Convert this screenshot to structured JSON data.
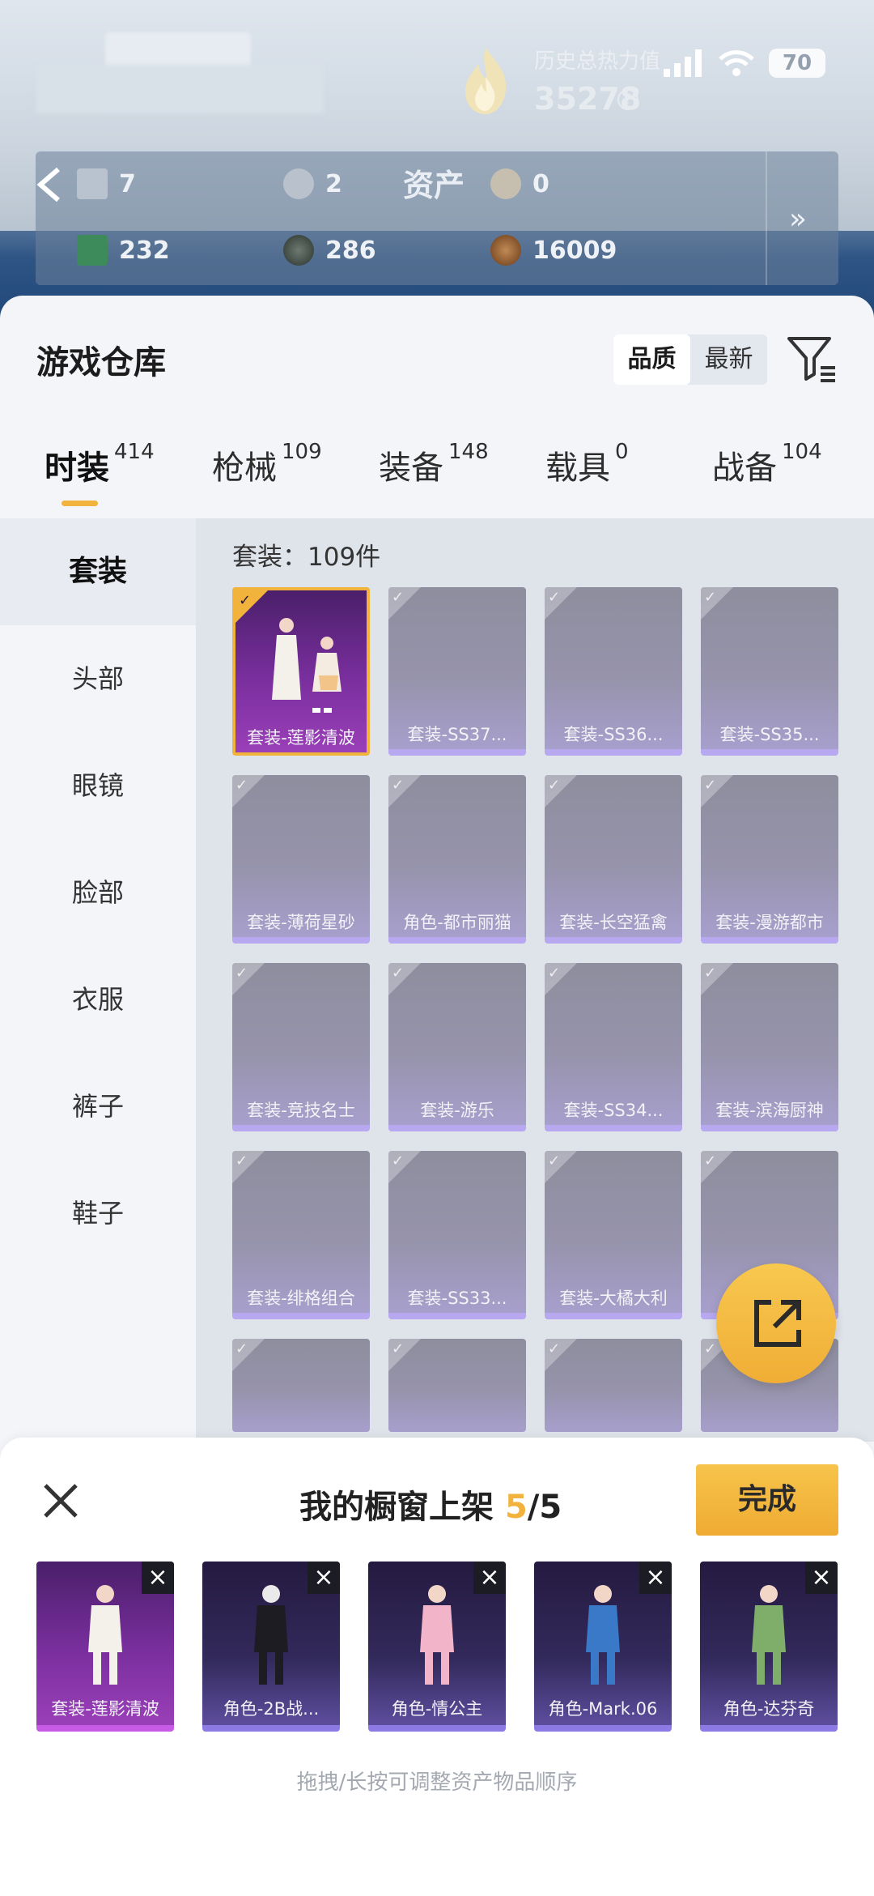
{
  "header": {
    "heat_label": "历史总热力值",
    "heat_value": "35278",
    "heat_help": "?",
    "battery": "70",
    "assets_title": "资产",
    "assets_top": [
      {
        "icon": "ticket-icon",
        "value": "7"
      },
      {
        "icon": "coin-silver-icon",
        "value": "2"
      },
      {
        "icon": "coin-gold-icon",
        "value": "0"
      }
    ],
    "assets_bottom": [
      {
        "icon": "green-card-icon",
        "value": "232"
      },
      {
        "icon": "dark-coin-icon",
        "value": "286"
      },
      {
        "icon": "bronze-coin-icon",
        "value": "16009"
      }
    ],
    "more_arrow": "»"
  },
  "warehouse": {
    "title": "游戏仓库",
    "sort_options": [
      "品质",
      "最新"
    ],
    "active_sort": "品质"
  },
  "tabs": [
    {
      "label": "时装",
      "count": "414"
    },
    {
      "label": "枪械",
      "count": "109"
    },
    {
      "label": "装备",
      "count": "148"
    },
    {
      "label": "载具",
      "count": "0"
    },
    {
      "label": "战备",
      "count": "104"
    }
  ],
  "sidebar": {
    "items": [
      "套装",
      "头部",
      "眼镜",
      "脸部",
      "衣服",
      "裤子",
      "鞋子"
    ]
  },
  "grid": {
    "count_label": "套装：109件",
    "items": [
      "套装-莲影清波",
      "套装-SS37...",
      "套装-SS36...",
      "套装-SS35...",
      "套装-薄荷星砂",
      "角色-都市丽猫",
      "套装-长空猛禽",
      "套装-漫游都市",
      "套装-竞技名士",
      "套装-游乐",
      "套装-SS34...",
      "套装-滨海厨神",
      "套装-绯格组合",
      "套装-SS33...",
      "套装-大橘大利",
      "",
      "",
      "",
      "",
      ""
    ]
  },
  "sheet": {
    "title_prefix": "我的橱窗上架 ",
    "title_current": "5",
    "title_total": "/5",
    "done_label": "完成",
    "items": [
      "套装-莲影清波",
      "角色-2B战...",
      "角色-情公主",
      "角色-Mark.06",
      "角色-达芬奇"
    ],
    "hint": "拖拽/长按可调整资产物品顺序"
  },
  "colors": {
    "accent": "#f2b33c",
    "tile_purple": "#9a3fb8",
    "tile_grey": "#9693ab"
  }
}
